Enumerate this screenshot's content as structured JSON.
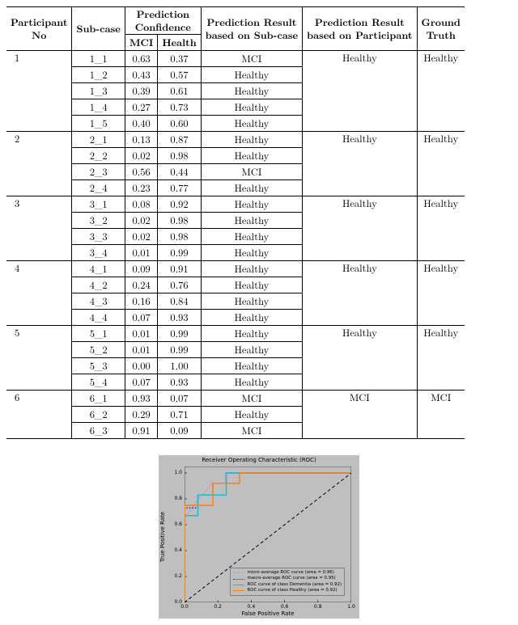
{
  "table": {
    "headers": {
      "participant": "Participant\nNo",
      "subcase": "Sub-case",
      "confidence": "Prediction\nConfidence",
      "mci": "MCI",
      "health": "Health",
      "res_sub": "Prediction Result\nbased on Sub-case",
      "res_part": "Prediction Result\nbased on Participant",
      "truth": "Ground\nTruth"
    },
    "participants": [
      {
        "no": "1",
        "res_part": "Healthy",
        "truth": "Healthy",
        "rows": [
          {
            "sub": "1_1",
            "mci": "0.63",
            "hp": "0.37",
            "res": "MCI"
          },
          {
            "sub": "1_2",
            "mci": "0.43",
            "hp": "0.57",
            "res": "Healthy"
          },
          {
            "sub": "1_3",
            "mci": "0.39",
            "hp": "0.61",
            "res": "Healthy"
          },
          {
            "sub": "1_4",
            "mci": "0.27",
            "hp": "0.73",
            "res": "Healthy"
          },
          {
            "sub": "1_5",
            "mci": "0.40",
            "hp": "0.60",
            "res": "Healthy"
          }
        ]
      },
      {
        "no": "2",
        "res_part": "Healthy",
        "truth": "Healthy",
        "rows": [
          {
            "sub": "2_1",
            "mci": "0.13",
            "hp": "0.87",
            "res": "Healthy"
          },
          {
            "sub": "2_2",
            "mci": "0.02",
            "hp": "0.98",
            "res": "Healthy"
          },
          {
            "sub": "2_3",
            "mci": "0.56",
            "hp": "0.44",
            "res": "MCI"
          },
          {
            "sub": "2_4",
            "mci": "0.23",
            "hp": "0.77",
            "res": "Healthy"
          }
        ]
      },
      {
        "no": "3",
        "res_part": "Healthy",
        "truth": "Healthy",
        "rows": [
          {
            "sub": "3_1",
            "mci": "0.08",
            "hp": "0.92",
            "res": "Healthy"
          },
          {
            "sub": "3_2",
            "mci": "0.02",
            "hp": "0.98",
            "res": "Healthy"
          },
          {
            "sub": "3_3",
            "mci": "0.02",
            "hp": "0.98",
            "res": "Healthy"
          },
          {
            "sub": "3_4",
            "mci": "0.01",
            "hp": "0.99",
            "res": "Healthy"
          }
        ]
      },
      {
        "no": "4",
        "res_part": "Healthy",
        "truth": "Healthy",
        "rows": [
          {
            "sub": "4_1",
            "mci": "0.09",
            "hp": "0.91",
            "res": "Healthy"
          },
          {
            "sub": "4_2",
            "mci": "0.24",
            "hp": "0.76",
            "res": "Healthy"
          },
          {
            "sub": "4_3",
            "mci": "0.16",
            "hp": "0.84",
            "res": "Healthy"
          },
          {
            "sub": "4_4",
            "mci": "0.07",
            "hp": "0.93",
            "res": "Healthy"
          }
        ]
      },
      {
        "no": "5",
        "res_part": "Healthy",
        "truth": "Healthy",
        "rows": [
          {
            "sub": "5_1",
            "mci": "0.01",
            "hp": "0.99",
            "res": "Healthy"
          },
          {
            "sub": "5_2",
            "mci": "0.01",
            "hp": "0.99",
            "res": "Healthy"
          },
          {
            "sub": "5_3",
            "mci": "0.00",
            "hp": "1.00",
            "res": "Healthy"
          },
          {
            "sub": "5_4",
            "mci": "0.07",
            "hp": "0.93",
            "res": "Healthy"
          }
        ]
      },
      {
        "no": "6",
        "res_part": "MCI",
        "truth": "MCI",
        "rows": [
          {
            "sub": "6_1",
            "mci": "0.93",
            "hp": "0.07",
            "res": "MCI"
          },
          {
            "sub": "6_2",
            "mci": "0.29",
            "hp": "0.71",
            "res": "Healthy"
          },
          {
            "sub": "6_3",
            "mci": "0.91",
            "hp": "0.09",
            "res": "MCI"
          }
        ]
      }
    ]
  },
  "chart_data": {
    "type": "line",
    "title": "Receiver Operating Characteristic (ROC)",
    "xlabel": "False Positive Rate",
    "ylabel": "True Positive Rate",
    "xlim": [
      0.0,
      1.0
    ],
    "ylim": [
      0.0,
      1.05
    ],
    "xticks": [
      "0.0",
      "0.2",
      "0.4",
      "0.6",
      "0.8",
      "1.0"
    ],
    "yticks": [
      "0.0",
      "0.2",
      "0.4",
      "0.6",
      "0.8",
      "1.0"
    ],
    "series": [
      {
        "name": "micro-average ROC curve (area = 0.96)",
        "color": "#e377c2",
        "style": "dotted",
        "points": [
          [
            0.0,
            0.0
          ],
          [
            0.0,
            0.67
          ],
          [
            0.03,
            0.7
          ],
          [
            0.05,
            0.73
          ],
          [
            0.07,
            0.78
          ],
          [
            0.08,
            0.8
          ],
          [
            0.1,
            0.82
          ],
          [
            0.12,
            0.85
          ],
          [
            0.13,
            0.87
          ],
          [
            0.15,
            0.9
          ],
          [
            0.17,
            0.92
          ],
          [
            0.25,
            0.92
          ],
          [
            0.25,
            1.0
          ],
          [
            1.0,
            1.0
          ]
        ]
      },
      {
        "name": "macro-average ROC curve (area = 0.95)",
        "color": "#1f3b9b",
        "style": "dotted",
        "points": [
          [
            0.0,
            0.0
          ],
          [
            0.0,
            0.73
          ],
          [
            0.08,
            0.73
          ],
          [
            0.08,
            0.83
          ],
          [
            0.17,
            0.83
          ],
          [
            0.17,
            0.92
          ],
          [
            0.25,
            0.92
          ],
          [
            0.25,
            1.0
          ],
          [
            1.0,
            1.0
          ]
        ]
      },
      {
        "name": "ROC curve of class Dementia (area = 0.92)",
        "color": "#17becf",
        "style": "solid",
        "points": [
          [
            0.0,
            0.0
          ],
          [
            0.0,
            0.67
          ],
          [
            0.08,
            0.67
          ],
          [
            0.08,
            0.83
          ],
          [
            0.25,
            0.83
          ],
          [
            0.25,
            1.0
          ],
          [
            1.0,
            1.0
          ]
        ]
      },
      {
        "name": "ROC curve of class Healthy (area = 0.92)",
        "color": "#ff7f0e",
        "style": "solid",
        "points": [
          [
            0.0,
            0.0
          ],
          [
            0.0,
            0.75
          ],
          [
            0.17,
            0.75
          ],
          [
            0.17,
            0.92
          ],
          [
            0.33,
            0.92
          ],
          [
            0.33,
            1.0
          ],
          [
            1.0,
            1.0
          ]
        ]
      },
      {
        "name": "diagonal",
        "color": "#000000",
        "style": "dashed",
        "points": [
          [
            0.0,
            0.0
          ],
          [
            1.0,
            1.0
          ]
        ],
        "hide_in_legend": true
      }
    ]
  }
}
